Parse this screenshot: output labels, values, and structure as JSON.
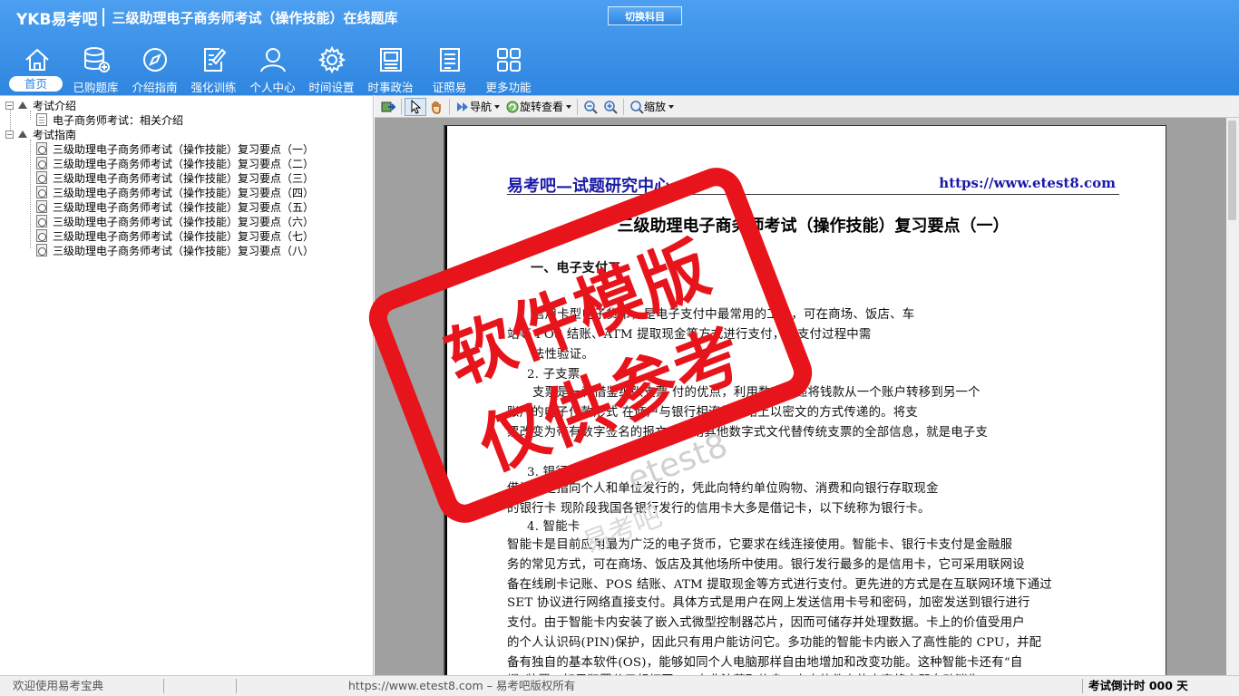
{
  "header": {
    "logo": "YKB易考吧",
    "title": "三级助理电子商务师考试（操作技能）在线题库",
    "switch_label": "切换科目"
  },
  "nav": [
    {
      "label": "首页",
      "icon": "home-icon"
    },
    {
      "label": "已购题库",
      "icon": "database-icon"
    },
    {
      "label": "介绍指南",
      "icon": "compass-icon"
    },
    {
      "label": "强化训练",
      "icon": "edit-icon"
    },
    {
      "label": "个人中心",
      "icon": "user-icon"
    },
    {
      "label": "时间设置",
      "icon": "gear-icon"
    },
    {
      "label": "时事政治",
      "icon": "newspaper-icon"
    },
    {
      "label": "证照易",
      "icon": "list-icon"
    },
    {
      "label": "更多功能",
      "icon": "grid-icon"
    }
  ],
  "tree": {
    "groups": [
      {
        "label": "考试介绍",
        "items": [
          "电子商务师考试：相关介绍"
        ]
      },
      {
        "label": "考试指南",
        "items": [
          "三级助理电子商务师考试（操作技能）复习要点（一）",
          "三级助理电子商务师考试（操作技能）复习要点（二）",
          "三级助理电子商务师考试（操作技能）复习要点（三）",
          "三级助理电子商务师考试（操作技能）复习要点（四）",
          "三级助理电子商务师考试（操作技能）复习要点（五）",
          "三级助理电子商务师考试（操作技能）复习要点（六）",
          "三级助理电子商务师考试（操作技能）复习要点（七）",
          "三级助理电子商务师考试（操作技能）复习要点（八）"
        ]
      }
    ]
  },
  "toolbar": {
    "nav_label": "导航",
    "rotate_label": "旋转查看",
    "zoom_label": "缩放"
  },
  "document": {
    "site_name": "易考吧—试题研究中心",
    "site_url": "https://www.etest8.com",
    "title": "三级助理电子商务师考试（操作技能）复习要点（一）",
    "lines": [
      "一、电子支付工",
      "",
      "信用卡型电子货币，是电子支付中最常用的工具，可在商场、饭店、车",
      "站等  POS 结账、ATM 提取现金等方式进行支付，其支付过程中需",
      "  法性验证。",
      "2. 子支票",
      "支票是一种借鉴纸张支票   付的优点，利用数字传递将钱款从一个账户转移到另一个",
      "账户的电子付款形式   在商户与银行相连的网络上以密文的方式传递的。将支",
      "票改变为带有数字签名的报文，利用其他数字式文代替传统支票的全部信息，就是电子支",
      "",
      "3. 银行卡",
      "借记卡是指向个人和单位发行的，凭此向特约单位购物、消费和向银行存取现金",
      "的银行卡   现阶段我国各银行发行的信用卡大多是借记卡，以下统称为银行卡。",
      "4. 智能卡",
      "    智能卡是目前应用最为广泛的电子货币，它要求在线连接使用。智能卡、银行卡支付是金融服",
      "务的常见方式，可在商场、饭店及其他场所中使用。银行发行最多的是信用卡，它可采用联网设",
      "备在线刷卡记账、POS 结账、ATM 提取现金等方式进行支付。更先进的方式是在互联网环境下通过",
      "SET 协议进行网络直接支付。具体方式是用户在网上发送信用卡号和密码，加密发送到银行进行",
      "支付。由于智能卡内安装了嵌入式微型控制器芯片，因而可储存并处理数据。卡上的价值受用户",
      "的个人认识码(PIN)保护，因此只有用户能访问它。多功能的智能卡内嵌入了高性能的 CPU，并配",
      "备有独自的基本软件(OS)，能够如同个人电脑那样自由地增加和改变功能。这种智能卡还有“自",
      "爆”装置，如果犯罪分子想打开 IC 卡非法获取信息，卡内软件上的内容将立即自动消失。"
    ]
  },
  "stamp": {
    "line1": "软件模版",
    "line2": "仅供参考",
    "color": "#e8141b"
  },
  "statusbar": {
    "welcome": "欢迎使用易考宝典",
    "copyright": "https://www.etest8.com – 易考吧版权所有",
    "countdown": "考试倒计时 000 天"
  }
}
